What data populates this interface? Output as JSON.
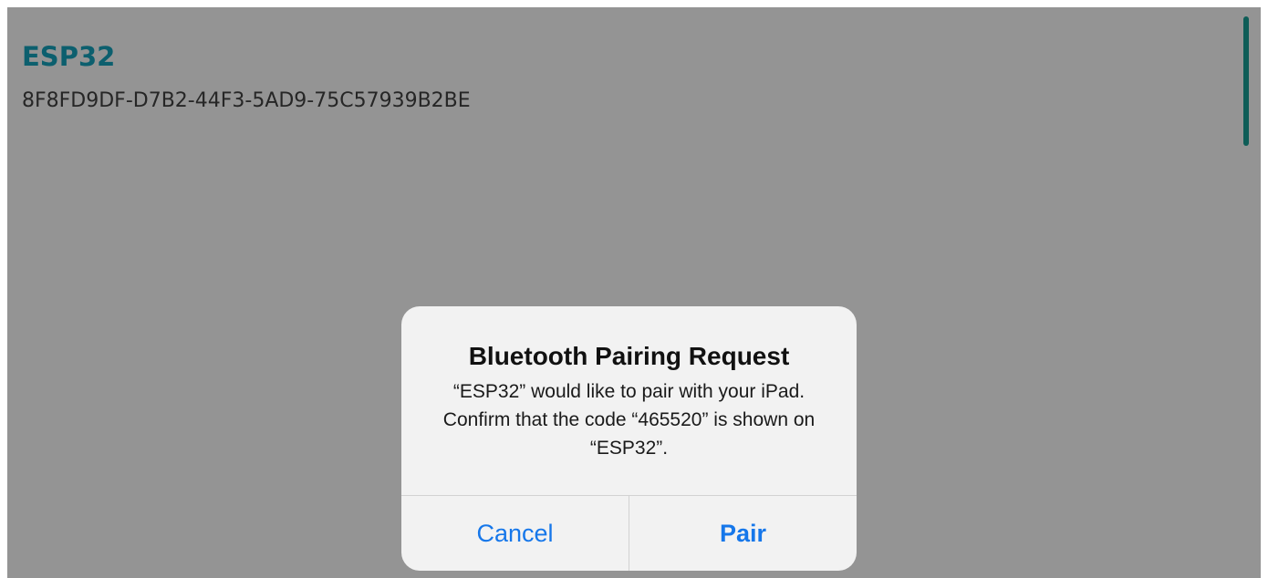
{
  "device": {
    "name": "ESP32",
    "uuid": "8F8FD9DF-D7B2-44F3-5AD9-75C57939B2BE"
  },
  "alert": {
    "title": "Bluetooth Pairing Request",
    "message": "“ESP32” would like to pair with your iPad. Confirm that the code “465520” is shown on “ESP32”.",
    "cancel_label": "Cancel",
    "confirm_label": "Pair"
  },
  "colors": {
    "overlay_background": "#949494",
    "device_name": "#0c5f6e",
    "scroll_indicator": "#0e5d57",
    "alert_background": "#f2f2f2",
    "action_blue": "#1677ea"
  }
}
